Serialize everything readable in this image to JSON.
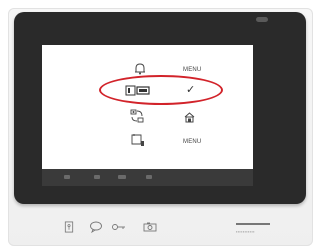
{
  "menu": {
    "row1": {
      "icon": "bell-icon",
      "label": "MENU"
    },
    "row2": {
      "icon": "video-intercom-icon",
      "label": "✓"
    },
    "row3": {
      "icon": "camera-switch-icon",
      "icon_right": "home-icon"
    },
    "row4": {
      "icon": "monitor-settings-icon",
      "label": "MENU"
    }
  },
  "hardware_buttons": [
    "door-key-icon",
    "speech-bubble-icon",
    "key-icon",
    "camera-icon"
  ],
  "highlight": {
    "color": "#d2232a",
    "target": "row2"
  },
  "colors": {
    "bezel": "#2a2a2a",
    "screen": "#ffffff",
    "body": "#f2f2f2"
  }
}
